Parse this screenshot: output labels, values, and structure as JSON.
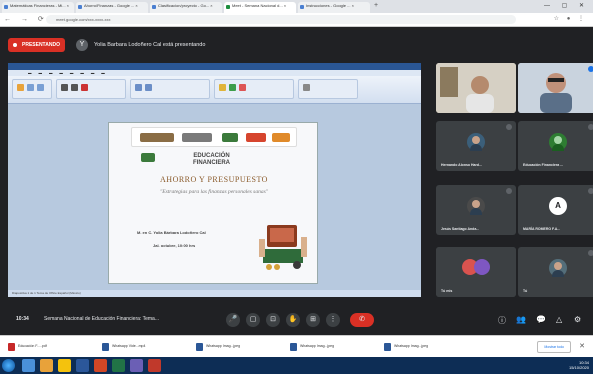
{
  "browser": {
    "tabs": [
      {
        "label": "Matemáticas Financieras - Mi... ×"
      },
      {
        "label": "Ahorro/Finanzas - Google ... ×"
      },
      {
        "label": "Clasificacion/proyecto - Go... ×"
      },
      {
        "label": "Meet - Semana Nacional d... ×"
      },
      {
        "label": "Instrucciones - Google ... ×"
      }
    ],
    "url": "meet.google.com/xxx-xxxx-xxx"
  },
  "meet": {
    "presenting_badge": "PRESENTANDO",
    "presenting_text": "Yolia Barbara Lodoñero Cal está presentando",
    "presenter_initial": "Y",
    "meeting_time": "10:34",
    "meeting_title": "Semana Nacional de Educación Financiera: Tema...",
    "end_call_color": "#d93025"
  },
  "slide": {
    "program_title_line1": "EDUCACIÓN",
    "program_title_line2": "FINANCIERA",
    "title": "AHORRO Y PRESUPUESTO",
    "subtitle": "\"Estrategias para las finanzas personales sanas\"",
    "presenter": "M. en C. Yolia Bárbara Lodoñero Cal",
    "date": "Jal. octubre, 10:00 hrs",
    "status_bar": "Diapositiva 1 de 1   Tema de Office   Español (México)"
  },
  "participants": [
    {
      "name": "",
      "kind": "video"
    },
    {
      "name": "",
      "kind": "video"
    },
    {
      "name": "Hernando Alonso Hard...",
      "kind": "avatar"
    },
    {
      "name": "Educación Financiera ...",
      "kind": "avatar"
    },
    {
      "name": "Jesús Santiago Anda...",
      "kind": "avatar"
    },
    {
      "name": "MARÍA ROMERO F.A...",
      "kind": "initial",
      "initial": "A"
    },
    {
      "name": "Tú mis",
      "kind": "video"
    },
    {
      "name": "Tú",
      "kind": "avatar"
    }
  ],
  "controls": {
    "buttons": [
      "mic-icon",
      "camera-icon",
      "captions-icon",
      "hand-icon",
      "present-icon",
      "more-icon"
    ],
    "glyphs": [
      "🎤",
      "▢",
      "⊡",
      "✋",
      "⊞",
      "⋮"
    ],
    "right_glyphs": [
      "ⓘ",
      "👥",
      "💬",
      "△",
      "⚙"
    ]
  },
  "downloads": [
    {
      "label": "Educación F.....pdf"
    },
    {
      "label": "Whatsapp Vide...mp4"
    },
    {
      "label": "Whatsapp Imag...jpeg"
    },
    {
      "label": "Whatsapp Imag...jpeg"
    },
    {
      "label": "Whatsapp Imag...jpeg"
    }
  ],
  "show_all": "Mostrar todo",
  "taskbar": {
    "time": "10:34",
    "date": "15/10/2020"
  }
}
